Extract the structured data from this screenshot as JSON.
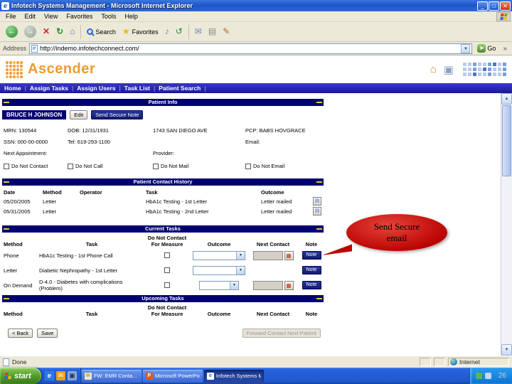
{
  "window": {
    "title": "Infotech Systems Management - Microsoft Internet Explorer"
  },
  "menubar": {
    "items": [
      "File",
      "Edit",
      "View",
      "Favorites",
      "Tools",
      "Help"
    ]
  },
  "toolbar": {
    "search_label": "Search",
    "favorites_label": "Favorites"
  },
  "addressbar": {
    "label": "Address",
    "value": "http://indemo.infotechconnect.com/",
    "go_label": "Go",
    "links_chevron": "»"
  },
  "banner": {
    "logo_text": "Ascender"
  },
  "nav": {
    "items": [
      "Home",
      "Assign Tasks",
      "Assign Users",
      "Task List",
      "Patient Search"
    ],
    "separator": "|"
  },
  "patient_info": {
    "header": "Patient Info",
    "name": "BRUCE H JOHNSON",
    "edit_button": "Edit",
    "secure_note_button": "Send Secure Note",
    "fields": {
      "mrn": "MRN: 130544",
      "ssn": "SSN: 000-00-0000",
      "dob": "DOB: 12/31/1931",
      "tel": "Tel: 619-293-1100",
      "address": "1743 SAN DIEGO AVE",
      "pcp": "PCP: BABS HOVGRACE",
      "email": "Email:",
      "next_appointment": "Next Appointment:",
      "provider": "Provider:"
    },
    "checkboxes": [
      "Do Not Contact",
      "Do Not Call",
      "Do Not Mail",
      "Do Not Email"
    ]
  },
  "contact_history": {
    "header": "Patient Contact History",
    "columns": [
      "Date",
      "Method",
      "Operator",
      "Task",
      "Outcome"
    ],
    "rows": [
      {
        "date": "05/20/2005",
        "method": "Letter",
        "operator": "",
        "task": "HbA1c Testing - 1st Letter",
        "outcome": "Letter mailed"
      },
      {
        "date": "05/31/2005",
        "method": "Letter",
        "operator": "",
        "task": "HbA1c Testing - 2nd Letter",
        "outcome": "Letter mailed"
      }
    ]
  },
  "current_tasks": {
    "header": "Current Tasks",
    "columns": {
      "method": "Method",
      "task": "Task",
      "do_not_contact": "Do Not Contact",
      "for_measure": "For Measure",
      "outcome": "Outcome",
      "next_contact": "Next Contact",
      "note": "Note"
    },
    "rows": [
      {
        "method": "Phone",
        "task": "HbA1c Testing - 1st Phone Call",
        "note_label": "Note"
      },
      {
        "method": "Letter",
        "task": "Diabetic Nephropathy - 1st Letter",
        "note_label": "Note"
      },
      {
        "method": "On Demand",
        "task": "D-4.0 - Diabetes with complications (Problem)",
        "note_label": "Note"
      }
    ]
  },
  "upcoming_tasks": {
    "header": "Upcoming Tasks",
    "columns": {
      "method": "Method",
      "task": "Task",
      "do_not_contact": "Do Not Contact",
      "for_measure": "For Measure",
      "outcome": "Outcome",
      "next_contact": "Next Contact",
      "note": "Note"
    }
  },
  "footer": {
    "back_button": "< Back",
    "save_button": "Save",
    "forward_button": "Forward Contact Next Patient"
  },
  "callout": {
    "line1": "Send Secure",
    "line2": "email"
  },
  "statusbar": {
    "left": "Done",
    "right": "Internet"
  },
  "taskbar": {
    "start_label": "start",
    "tasks": [
      "FW: EMR Conta...",
      "Microsoft PowerPoint",
      "Infotech Systems Ma..."
    ],
    "slide_number": "26"
  }
}
